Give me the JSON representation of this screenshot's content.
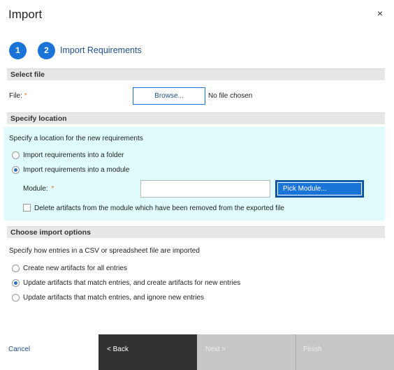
{
  "dialog": {
    "title": "Import",
    "close_glyph": "×"
  },
  "steps": [
    {
      "number": "1"
    },
    {
      "number": "2",
      "label": "Import Requirements"
    }
  ],
  "select_file": {
    "header": "Select file",
    "file_label": "File:",
    "required_mark": "*",
    "browse_label": "Browse...",
    "file_status": "No file chosen"
  },
  "specify_location": {
    "header": "Specify location",
    "intro": "Specify a location for the new requirements",
    "options": [
      {
        "label": "Import requirements into a folder",
        "selected": false
      },
      {
        "label": "Import requirements into a module",
        "selected": true
      }
    ],
    "module_label": "Module:",
    "required_mark": "*",
    "module_value": "",
    "pick_module_label": "Pick Module...",
    "delete_checkbox_label": "Delete artifacts from the module which have been removed from the exported file",
    "delete_checked": false
  },
  "import_options": {
    "header": "Choose import options",
    "intro": "Specify how entries in a CSV or spreadsheet file are imported",
    "options": [
      {
        "label": "Create new artifacts for all entries",
        "selected": false
      },
      {
        "label": "Update artifacts that match entries, and create artifacts for new entries",
        "selected": true
      },
      {
        "label": "Update artifacts that match entries, and ignore new entries",
        "selected": false
      }
    ]
  },
  "footer": {
    "cancel_label": "Cancel",
    "back_label": "< Back",
    "next_label": "Next >",
    "finish_label": "Finish"
  },
  "colors": {
    "accent": "#1a73d6",
    "highlight": "#dffbfb",
    "back_bg": "#323232",
    "disabled_bg": "#c6c6c6",
    "required": "#e87722"
  }
}
